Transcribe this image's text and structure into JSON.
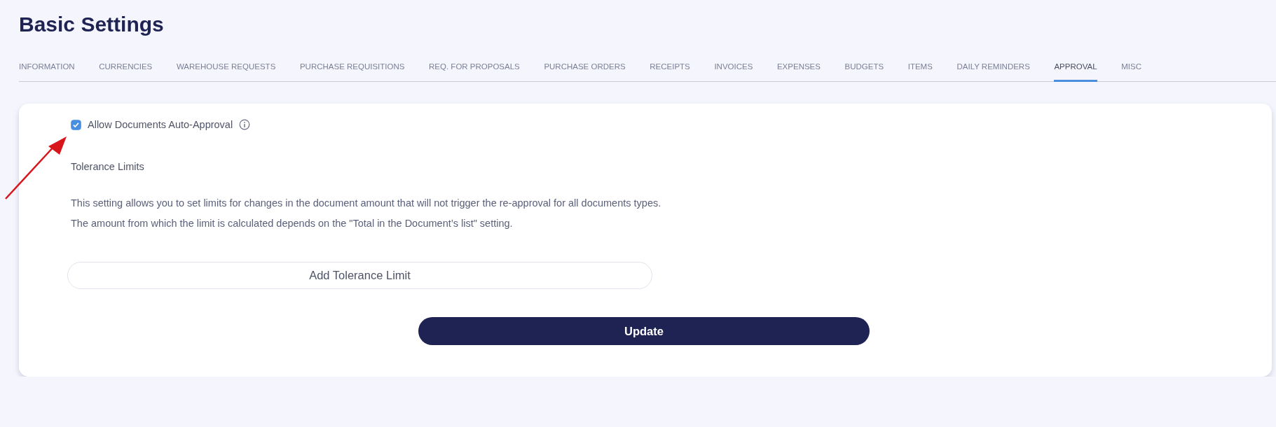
{
  "page": {
    "title": "Basic Settings"
  },
  "tabs": [
    {
      "label": "INFORMATION",
      "selected": false
    },
    {
      "label": "CURRENCIES",
      "selected": false
    },
    {
      "label": "WAREHOUSE REQUESTS",
      "selected": false
    },
    {
      "label": "PURCHASE REQUISITIONS",
      "selected": false
    },
    {
      "label": "REQ. FOR PROPOSALS",
      "selected": false
    },
    {
      "label": "PURCHASE ORDERS",
      "selected": false
    },
    {
      "label": "RECEIPTS",
      "selected": false
    },
    {
      "label": "INVOICES",
      "selected": false
    },
    {
      "label": "EXPENSES",
      "selected": false
    },
    {
      "label": "BUDGETS",
      "selected": false
    },
    {
      "label": "ITEMS",
      "selected": false
    },
    {
      "label": "DAILY REMINDERS",
      "selected": false
    },
    {
      "label": "APPROVAL",
      "selected": true
    },
    {
      "label": "MISC",
      "selected": false
    }
  ],
  "approval": {
    "auto_approval": {
      "label": "Allow Documents Auto-Approval",
      "checked": true
    },
    "section_title": "Tolerance Limits",
    "description": [
      "This setting allows you to set limits for changes in the document amount that will not trigger the re-approval for all documents types.",
      "The amount from which the limit is calculated depends on the \"Total in the Document’s list\" setting."
    ],
    "add_button": "Add Tolerance Limit",
    "update_button": "Update"
  }
}
